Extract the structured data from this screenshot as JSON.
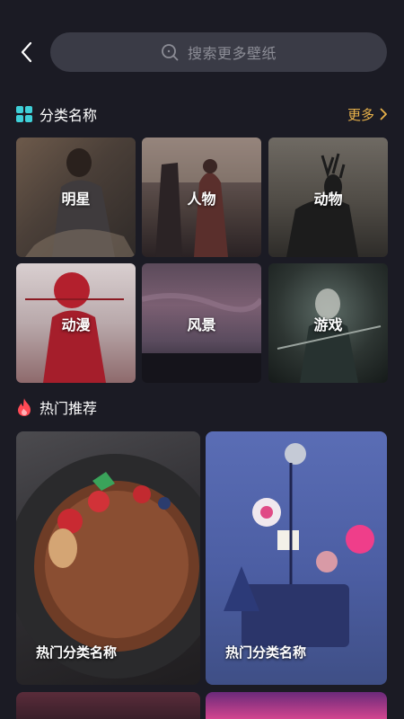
{
  "search": {
    "placeholder": "搜索更多壁纸"
  },
  "categories": {
    "title": "分类名称",
    "more_label": "更多",
    "items": [
      {
        "label": "明星"
      },
      {
        "label": "人物"
      },
      {
        "label": "动物"
      },
      {
        "label": "动漫"
      },
      {
        "label": "风景"
      },
      {
        "label": "游戏"
      }
    ]
  },
  "hot": {
    "title": "热门推荐",
    "items": [
      {
        "label": "热门分类名称"
      },
      {
        "label": "热门分类名称"
      }
    ]
  },
  "colors": {
    "background": "#1b1b24",
    "search_bg": "#3a3b46",
    "accent_more": "#e9b24a",
    "category_icon": "#3fd0d8",
    "hot_icon": "#ff4a55"
  },
  "icons": {
    "back": "chevron-left-icon",
    "search": "search-icon",
    "category": "grid-icon",
    "more": "chevron-right-icon",
    "hot": "flame-icon"
  }
}
